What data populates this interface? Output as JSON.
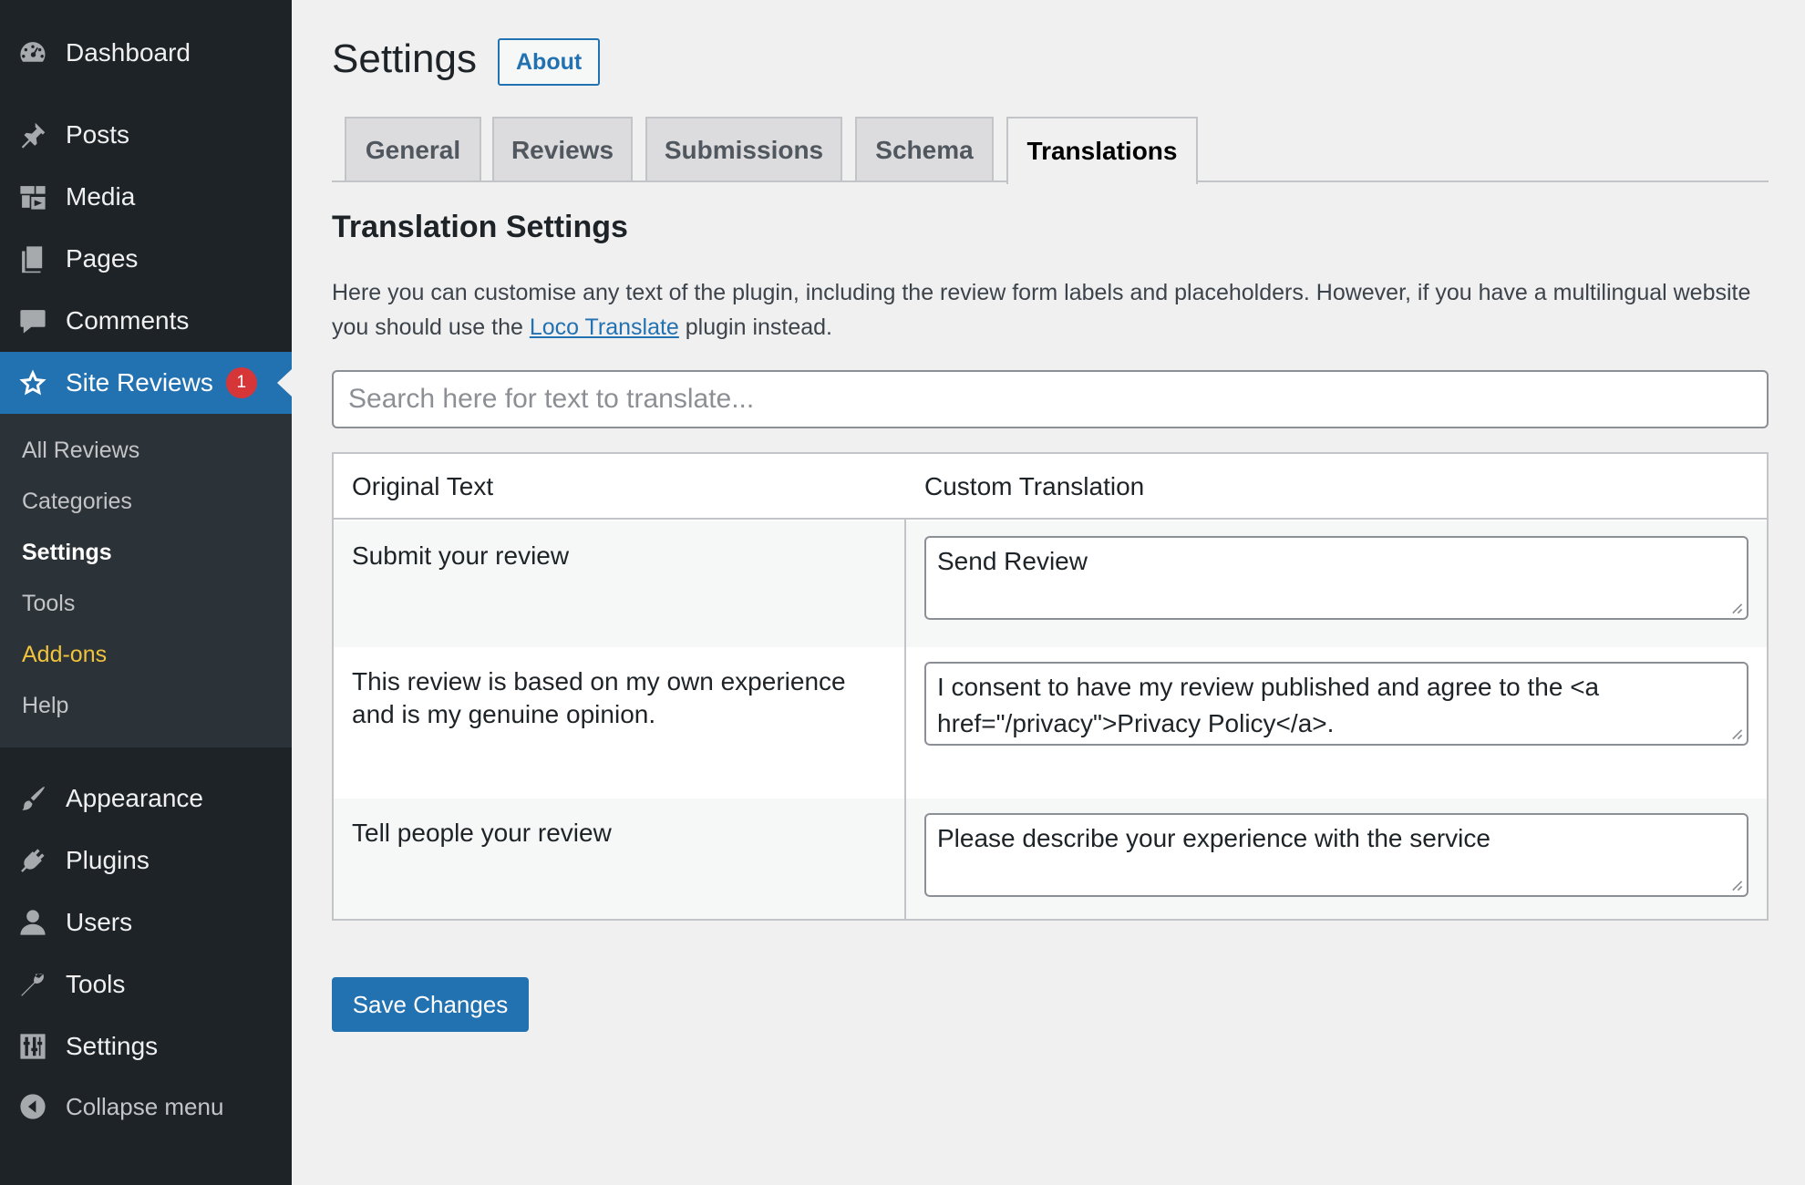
{
  "sidebar": {
    "items": [
      {
        "label": "Dashboard",
        "icon": "dashboard-icon"
      },
      {
        "label": "Posts",
        "icon": "pin-icon"
      },
      {
        "label": "Media",
        "icon": "media-icon"
      },
      {
        "label": "Pages",
        "icon": "pages-icon"
      },
      {
        "label": "Comments",
        "icon": "comment-icon"
      },
      {
        "label": "Site Reviews",
        "icon": "star-icon",
        "badge": "1"
      },
      {
        "label": "Appearance",
        "icon": "brush-icon"
      },
      {
        "label": "Plugins",
        "icon": "plug-icon"
      },
      {
        "label": "Users",
        "icon": "user-icon"
      },
      {
        "label": "Tools",
        "icon": "wrench-icon"
      },
      {
        "label": "Settings",
        "icon": "sliders-icon"
      }
    ],
    "submenu": [
      "All Reviews",
      "Categories",
      "Settings",
      "Tools",
      "Add-ons",
      "Help"
    ],
    "collapse_label": "Collapse menu"
  },
  "header": {
    "title": "Settings",
    "about_label": "About"
  },
  "tabs": [
    "General",
    "Reviews",
    "Submissions",
    "Schema",
    "Translations"
  ],
  "active_tab": "Translations",
  "section": {
    "title": "Translation Settings",
    "intro_before": "Here you can customise any text of the plugin, including the review form labels and placeholders. However, if you have a multilingual website you should use the ",
    "intro_link": "Loco Translate",
    "intro_after": " plugin instead."
  },
  "search": {
    "placeholder": "Search here for text to translate...",
    "value": ""
  },
  "table": {
    "headers": [
      "Original Text",
      "Custom Translation"
    ],
    "rows": [
      {
        "original": "Submit your review",
        "translation": "Send Review"
      },
      {
        "original": "This review is based on my own experience and is my genuine opinion.",
        "translation": "I consent to have my review published and agree to the <a href=\"/privacy\">Privacy Policy</a>."
      },
      {
        "original": "Tell people your review",
        "translation": "Please describe your experience with the service"
      }
    ]
  },
  "save_label": "Save Changes",
  "colors": {
    "sidebar_bg": "#1d2327",
    "submenu_bg": "#2c3338",
    "accent": "#2271b1",
    "badge": "#d63638",
    "addons": "#f0c33c"
  }
}
